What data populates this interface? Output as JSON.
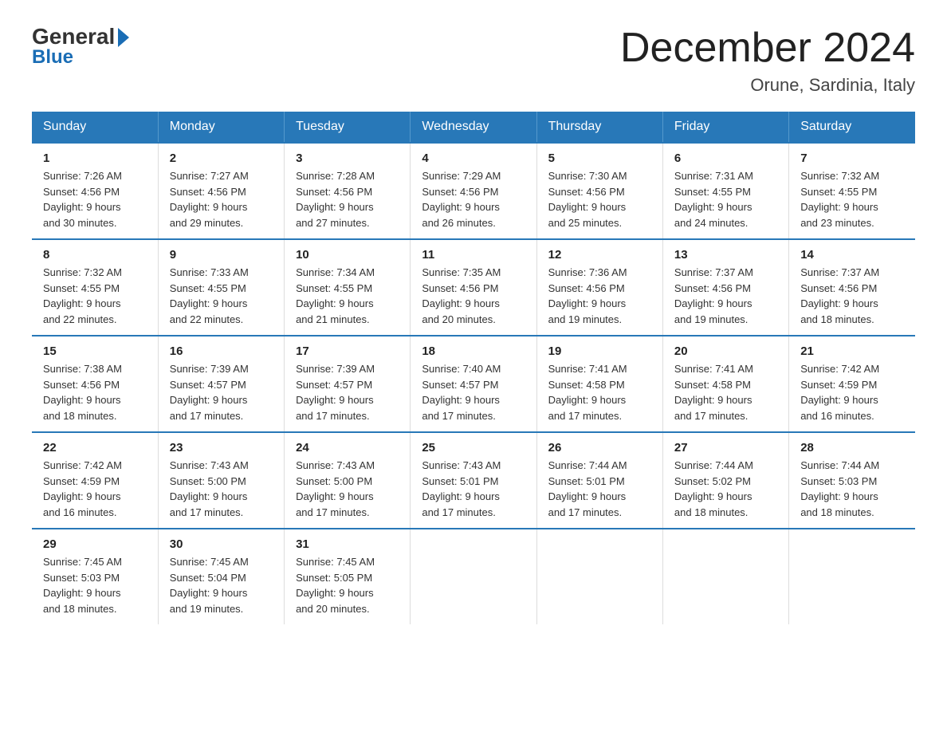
{
  "logo": {
    "general": "General",
    "blue": "Blue"
  },
  "title": "December 2024",
  "location": "Orune, Sardinia, Italy",
  "header": {
    "days": [
      "Sunday",
      "Monday",
      "Tuesday",
      "Wednesday",
      "Thursday",
      "Friday",
      "Saturday"
    ]
  },
  "weeks": [
    [
      {
        "day": "1",
        "sunrise": "7:26 AM",
        "sunset": "4:56 PM",
        "daylight": "9 hours and 30 minutes."
      },
      {
        "day": "2",
        "sunrise": "7:27 AM",
        "sunset": "4:56 PM",
        "daylight": "9 hours and 29 minutes."
      },
      {
        "day": "3",
        "sunrise": "7:28 AM",
        "sunset": "4:56 PM",
        "daylight": "9 hours and 27 minutes."
      },
      {
        "day": "4",
        "sunrise": "7:29 AM",
        "sunset": "4:56 PM",
        "daylight": "9 hours and 26 minutes."
      },
      {
        "day": "5",
        "sunrise": "7:30 AM",
        "sunset": "4:56 PM",
        "daylight": "9 hours and 25 minutes."
      },
      {
        "day": "6",
        "sunrise": "7:31 AM",
        "sunset": "4:55 PM",
        "daylight": "9 hours and 24 minutes."
      },
      {
        "day": "7",
        "sunrise": "7:32 AM",
        "sunset": "4:55 PM",
        "daylight": "9 hours and 23 minutes."
      }
    ],
    [
      {
        "day": "8",
        "sunrise": "7:32 AM",
        "sunset": "4:55 PM",
        "daylight": "9 hours and 22 minutes."
      },
      {
        "day": "9",
        "sunrise": "7:33 AM",
        "sunset": "4:55 PM",
        "daylight": "9 hours and 22 minutes."
      },
      {
        "day": "10",
        "sunrise": "7:34 AM",
        "sunset": "4:55 PM",
        "daylight": "9 hours and 21 minutes."
      },
      {
        "day": "11",
        "sunrise": "7:35 AM",
        "sunset": "4:56 PM",
        "daylight": "9 hours and 20 minutes."
      },
      {
        "day": "12",
        "sunrise": "7:36 AM",
        "sunset": "4:56 PM",
        "daylight": "9 hours and 19 minutes."
      },
      {
        "day": "13",
        "sunrise": "7:37 AM",
        "sunset": "4:56 PM",
        "daylight": "9 hours and 19 minutes."
      },
      {
        "day": "14",
        "sunrise": "7:37 AM",
        "sunset": "4:56 PM",
        "daylight": "9 hours and 18 minutes."
      }
    ],
    [
      {
        "day": "15",
        "sunrise": "7:38 AM",
        "sunset": "4:56 PM",
        "daylight": "9 hours and 18 minutes."
      },
      {
        "day": "16",
        "sunrise": "7:39 AM",
        "sunset": "4:57 PM",
        "daylight": "9 hours and 17 minutes."
      },
      {
        "day": "17",
        "sunrise": "7:39 AM",
        "sunset": "4:57 PM",
        "daylight": "9 hours and 17 minutes."
      },
      {
        "day": "18",
        "sunrise": "7:40 AM",
        "sunset": "4:57 PM",
        "daylight": "9 hours and 17 minutes."
      },
      {
        "day": "19",
        "sunrise": "7:41 AM",
        "sunset": "4:58 PM",
        "daylight": "9 hours and 17 minutes."
      },
      {
        "day": "20",
        "sunrise": "7:41 AM",
        "sunset": "4:58 PM",
        "daylight": "9 hours and 17 minutes."
      },
      {
        "day": "21",
        "sunrise": "7:42 AM",
        "sunset": "4:59 PM",
        "daylight": "9 hours and 16 minutes."
      }
    ],
    [
      {
        "day": "22",
        "sunrise": "7:42 AM",
        "sunset": "4:59 PM",
        "daylight": "9 hours and 16 minutes."
      },
      {
        "day": "23",
        "sunrise": "7:43 AM",
        "sunset": "5:00 PM",
        "daylight": "9 hours and 17 minutes."
      },
      {
        "day": "24",
        "sunrise": "7:43 AM",
        "sunset": "5:00 PM",
        "daylight": "9 hours and 17 minutes."
      },
      {
        "day": "25",
        "sunrise": "7:43 AM",
        "sunset": "5:01 PM",
        "daylight": "9 hours and 17 minutes."
      },
      {
        "day": "26",
        "sunrise": "7:44 AM",
        "sunset": "5:01 PM",
        "daylight": "9 hours and 17 minutes."
      },
      {
        "day": "27",
        "sunrise": "7:44 AM",
        "sunset": "5:02 PM",
        "daylight": "9 hours and 18 minutes."
      },
      {
        "day": "28",
        "sunrise": "7:44 AM",
        "sunset": "5:03 PM",
        "daylight": "9 hours and 18 minutes."
      }
    ],
    [
      {
        "day": "29",
        "sunrise": "7:45 AM",
        "sunset": "5:03 PM",
        "daylight": "9 hours and 18 minutes."
      },
      {
        "day": "30",
        "sunrise": "7:45 AM",
        "sunset": "5:04 PM",
        "daylight": "9 hours and 19 minutes."
      },
      {
        "day": "31",
        "sunrise": "7:45 AM",
        "sunset": "5:05 PM",
        "daylight": "9 hours and 20 minutes."
      },
      null,
      null,
      null,
      null
    ]
  ],
  "labels": {
    "sunrise": "Sunrise:",
    "sunset": "Sunset:",
    "daylight": "Daylight:"
  }
}
